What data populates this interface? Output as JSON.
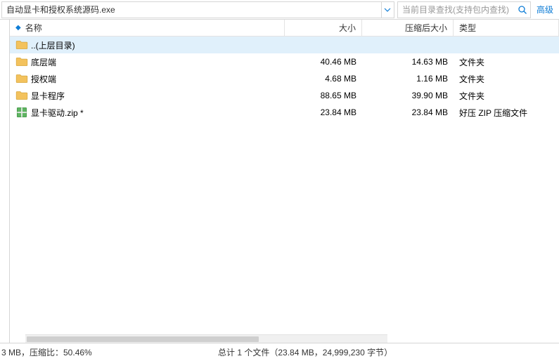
{
  "path": "自动显卡和授权系统源码.exe",
  "search": {
    "placeholder": "当前目录查找(支持包内查找)"
  },
  "advanced_label": "高级",
  "columns": {
    "name": "名称",
    "size": "大小",
    "compressed": "压缩后大小",
    "type": "类型"
  },
  "rows": [
    {
      "icon": "folder-up",
      "name": "..(上层目录)",
      "size": "",
      "compressed": "",
      "type": ""
    },
    {
      "icon": "folder",
      "name": "底层端",
      "size": "40.46 MB",
      "compressed": "14.63 MB",
      "type": "文件夹"
    },
    {
      "icon": "folder",
      "name": "授权端",
      "size": "4.68 MB",
      "compressed": "1.16 MB",
      "type": "文件夹"
    },
    {
      "icon": "folder",
      "name": "显卡程序",
      "size": "88.65 MB",
      "compressed": "39.90 MB",
      "type": "文件夹"
    },
    {
      "icon": "zip",
      "name": "显卡驱动.zip *",
      "size": "23.84 MB",
      "compressed": "23.84 MB",
      "type": "好压 ZIP 压缩文件"
    }
  ],
  "status": {
    "left": "3 MB，压缩比：50.46%",
    "center": "总计 1 个文件（23.84 MB，24,999,230 字节）"
  }
}
